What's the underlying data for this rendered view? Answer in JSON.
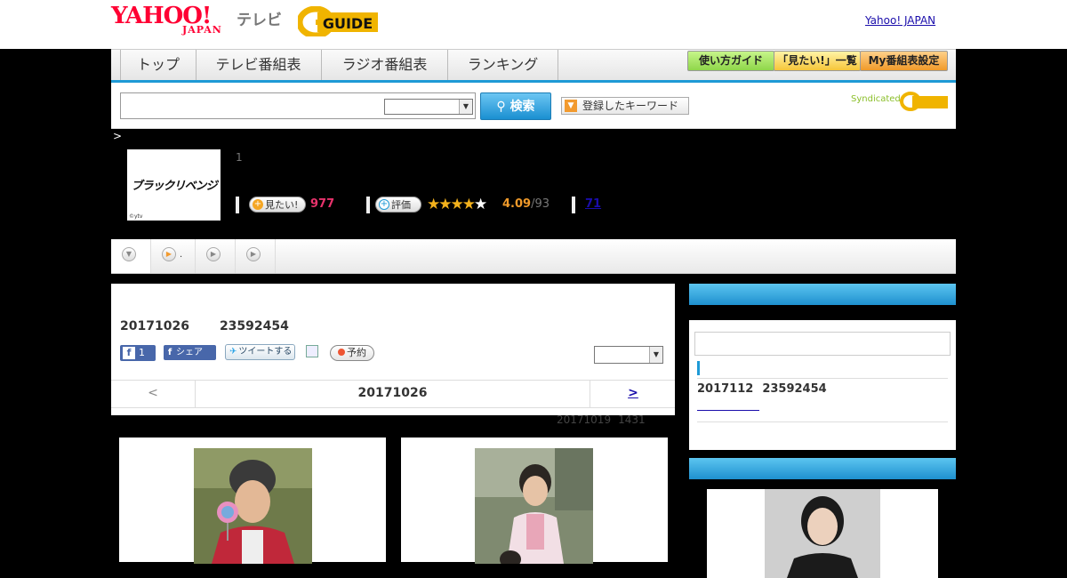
{
  "header": {
    "logo_yahoo": "YAHOO!",
    "logo_japan": "JAPAN",
    "logo_tv": "テレビ",
    "logo_gguide": "G-GUIDE",
    "yahoo_japan_link": "Yahoo! JAPAN"
  },
  "nav": {
    "tabs": [
      "トップ",
      "テレビ番組表",
      "ラジオ番組表",
      "ランキング"
    ],
    "guide": "使い方ガイド",
    "mitai_list": "「見たい!」一覧",
    "my_schedule": "My番組表設定"
  },
  "search": {
    "button": "検索",
    "keywords": "登録したキーワード",
    "syndicated": "Syndicated"
  },
  "program": {
    "breadcrumb": ">",
    "thumb_title": "ブラックリベンジ",
    "thumb_credit": "©ytv",
    "episode": "1",
    "mitai_label": "見たい!",
    "mitai_count": "977",
    "rating_label": "評価",
    "rating_stars": 4,
    "rating": "4.09",
    "rating_count": "/93",
    "link_count": "71"
  },
  "tabs": {
    "second_tab_suffix": "."
  },
  "main": {
    "date_id": "20171026",
    "program_id": "23592454",
    "fb_count": "1",
    "share": "シェア",
    "tweet": "ツイートする",
    "reserve": "予約",
    "prev": "<",
    "current_date": "20171026",
    "next": ">",
    "updated_date": "20171019",
    "updated_time": "1431"
  },
  "sidebar": {
    "date_id": "2017112",
    "program_id": "23592454"
  },
  "colors": {
    "brand_red": "#ff0033",
    "accent_blue": "#1e9ad6",
    "mitai_pink": "#e8336c",
    "rating_orange": "#f09a2a"
  }
}
